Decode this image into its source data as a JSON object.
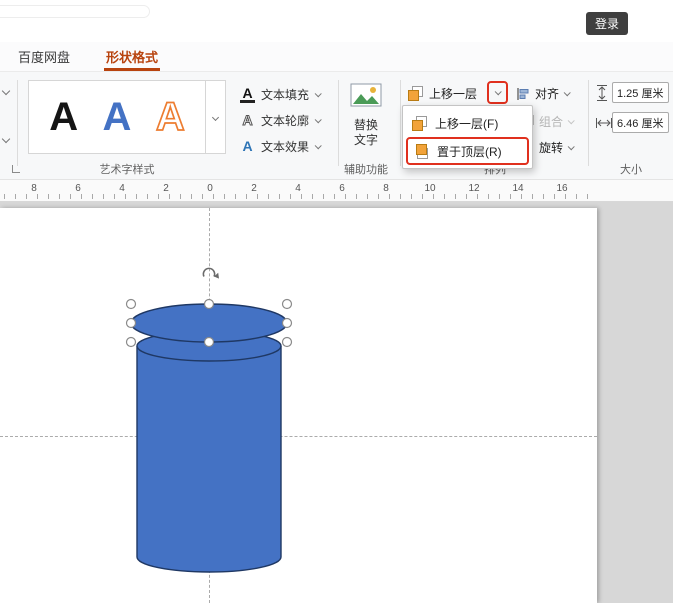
{
  "colors": {
    "accent_tab": "#b8430e",
    "highlight_red": "#e0301e",
    "shape_fill": "#4472c4",
    "shape_stroke": "#1f3864",
    "icon_orange": "#f2a33a"
  },
  "titlebar": {
    "login_label": "登录"
  },
  "tabs": {
    "tab1": "百度网盘",
    "tab2": "形状格式"
  },
  "ribbon": {
    "wordart": {
      "sample1": "A",
      "sample2": "A",
      "sample3": "A",
      "caption": "艺术字样式"
    },
    "text_styles": {
      "icon_letter": "A",
      "fill": "文本填充",
      "outline": "文本轮廓",
      "effects": "文本效果"
    },
    "accessibility": {
      "line1": "替换",
      "line2": "文字",
      "caption": "辅助功能"
    },
    "arrange": {
      "bring_forward": "上移一层",
      "align": "对齐",
      "group": "组合",
      "rotate": "旋转",
      "caption": "排列",
      "menu_item1": "上移一层(F)",
      "menu_item2": "置于顶层(R)"
    },
    "size": {
      "height_value": "1.25 厘米",
      "width_value": "6.46 厘米",
      "caption": "大小"
    }
  },
  "ruler": {
    "labels": [
      "8",
      "6",
      "4",
      "2",
      "0",
      "2",
      "4",
      "6",
      "8",
      "10",
      "12",
      "14",
      "16"
    ]
  }
}
